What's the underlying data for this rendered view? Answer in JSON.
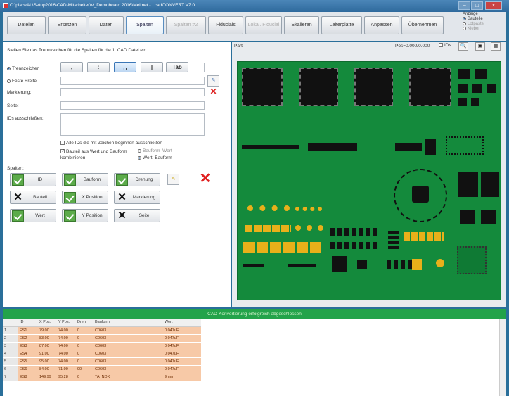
{
  "window": {
    "title": "C:\\placeAL\\Setup2016\\CAD-Mitarbeiter\\V_Demoboard 2016\\Melmet - ..cadCONVERT V7.0"
  },
  "toolbar": {
    "buttons": [
      {
        "label": "Dateien"
      },
      {
        "label": "Ersetzen"
      },
      {
        "label": "Daten"
      },
      {
        "label": "Spalten"
      },
      {
        "label": "Spalten #2"
      },
      {
        "label": "Fiducials"
      },
      {
        "label": "Lokal. Fiducial"
      },
      {
        "label": "Skalieren"
      },
      {
        "label": "Leiterplatte"
      },
      {
        "label": "Anpassen"
      },
      {
        "label": "Übernehmen"
      }
    ],
    "anzeige": {
      "title": "Anzeige",
      "options": [
        "Bauteile",
        "Lotpaste",
        "Kleber"
      ],
      "selected": "Bauteile"
    }
  },
  "left": {
    "instruction": "Stellen Sie das Trennzeichen für die Spalten für die 1. CAD Datei ein.",
    "trennzeichen_label": "Trennzeichen",
    "separators": [
      ",",
      ":",
      "␣",
      "|",
      "Tab"
    ],
    "feste_breite_label": "Feste Breite",
    "markierung_label": "Markierung:",
    "seite_label": "Seite:",
    "ids_label": "IDs ausschließen:",
    "check_ids": "Alle IDs die mit Zeichen beginnen ausschließen",
    "check_kombi": "Bauteil aus Wert und Bauform kombinieren",
    "radio_bauform_wert": "Bauform_Wert",
    "radio_wert_bauform": "Wert_Bauform",
    "spalten_label": "Spalten:",
    "columns": [
      {
        "label": "ID",
        "state": "ok"
      },
      {
        "label": "Bauform",
        "state": "ok"
      },
      {
        "label": "Drehung",
        "state": "ok"
      },
      {
        "label": "Bauteil",
        "state": "no"
      },
      {
        "label": "X Position",
        "state": "ok"
      },
      {
        "label": "Markierung",
        "state": "no"
      },
      {
        "label": "Wert",
        "state": "ok"
      },
      {
        "label": "Y Position",
        "state": "ok"
      },
      {
        "label": "Seite",
        "state": "no"
      }
    ]
  },
  "right": {
    "label": "Part",
    "pos": "Pos=0.000/0.000",
    "ids": "IDs"
  },
  "status": "CAD-Konvertierung erfolgreich abgeschlossen",
  "table": {
    "headers": [
      "",
      "ID",
      "X Pos.",
      "Y Pos.",
      "Dreh.",
      "Bauform",
      "Wert"
    ],
    "rows": [
      [
        "1",
        "ES1",
        "79.00",
        "74.00",
        "0",
        "C0603",
        "0,047uF"
      ],
      [
        "2",
        "ES2",
        "83.00",
        "74.00",
        "0",
        "C0603",
        "0,047uF"
      ],
      [
        "3",
        "ES3",
        "87.00",
        "74.00",
        "0",
        "C0603",
        "0,047uF"
      ],
      [
        "4",
        "ES4",
        "91.00",
        "74.00",
        "0",
        "C0603",
        "0,047uF"
      ],
      [
        "5",
        "ES5",
        "95.00",
        "74.00",
        "0",
        "C0603",
        "0,047uF"
      ],
      [
        "6",
        "ES6",
        "84.00",
        "71.00",
        "90",
        "C0603",
        "0,047uF"
      ],
      [
        "7",
        "ES8",
        "149.99",
        "95.28",
        "0",
        "TA_NDK",
        "9mm"
      ]
    ]
  }
}
